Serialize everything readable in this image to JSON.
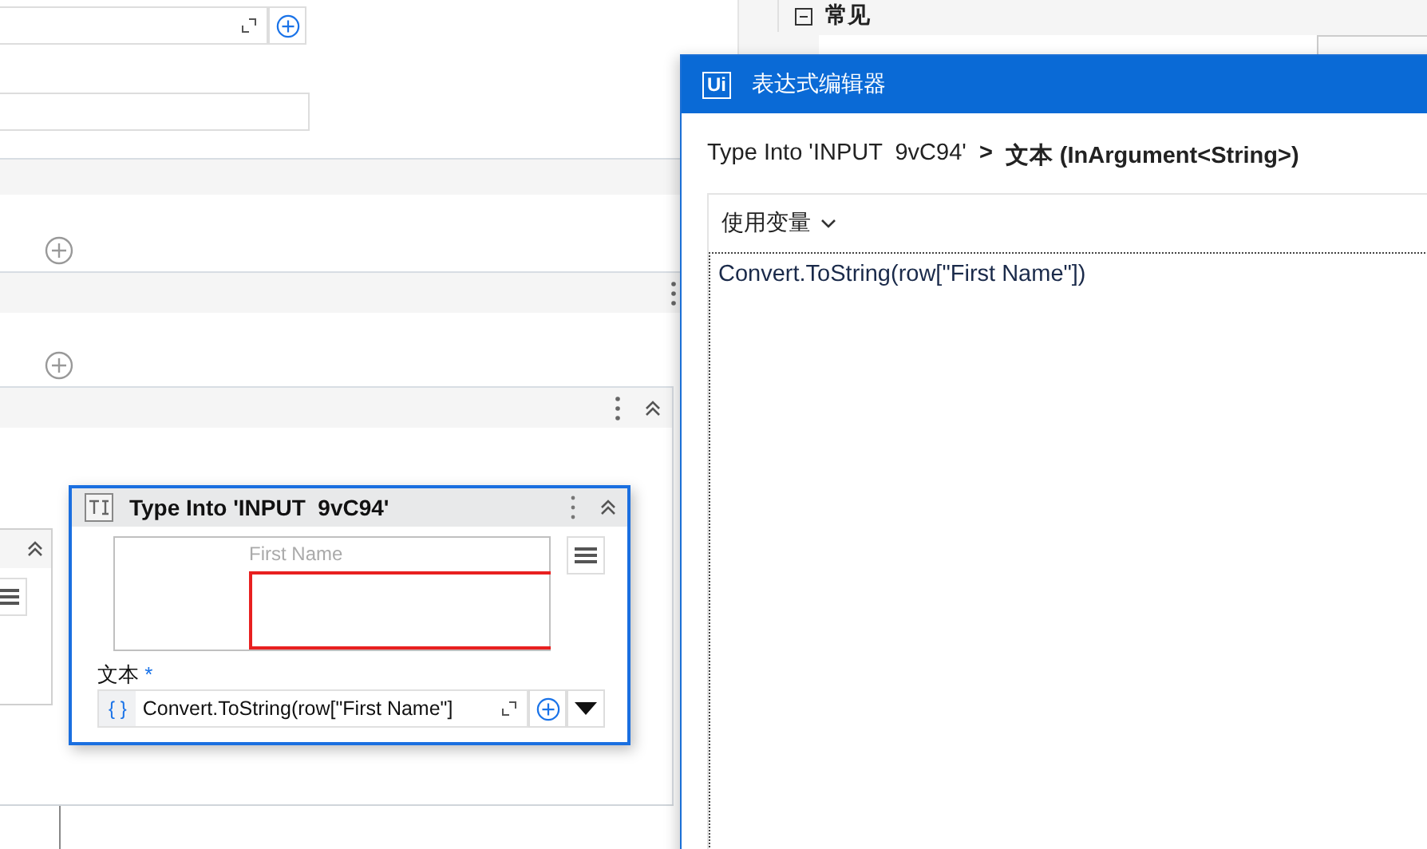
{
  "properties_panel": {
    "section": {
      "expanded": true,
      "title": "常见"
    }
  },
  "activity_card": {
    "title": "Type Into 'INPUT  9vC94'",
    "selected": true,
    "preview_label": "First Name",
    "field_label": "文本",
    "required_mark": "*",
    "field_prefix": "{ }",
    "field_value": "Convert.ToString(row[\"First Name\"]"
  },
  "dialog": {
    "logo": "Ui",
    "title": "表达式编辑器",
    "breadcrumb_activity": "Type Into 'INPUT  9vC94'",
    "breadcrumb_separator": ">",
    "breadcrumb_property": "文本 (InArgument<String>)",
    "variables_button": "使用变量",
    "expression": "Convert.ToString(row[\"First Name\"])"
  }
}
